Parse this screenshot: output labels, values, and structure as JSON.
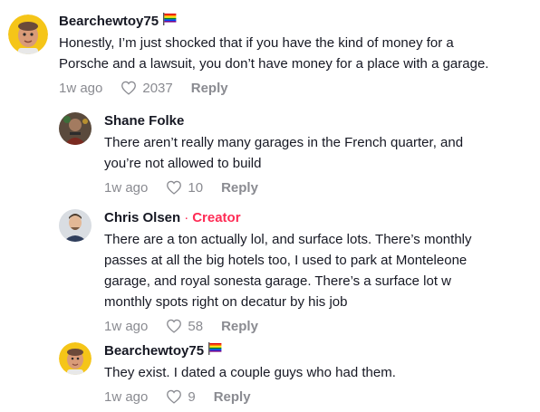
{
  "comments": [
    {
      "username": "Bearchewtoy75",
      "flag": "rainbow-flag-icon",
      "badge": "",
      "text_lines": [
        "Honestly, I’m just shocked that if you have the kind of money for a",
        "Porsche and a lawsuit, you don’t have money for a place with a garage."
      ],
      "time": "1w ago",
      "likes": "2037",
      "reply_label": "Reply"
    },
    {
      "username": "Shane Folke",
      "flag": "",
      "badge": "",
      "text_lines": [
        "There aren’t really many garages in the French quarter, and",
        "you’re not allowed to build"
      ],
      "time": "1w ago",
      "likes": "10",
      "reply_label": "Reply"
    },
    {
      "username": "Chris Olsen",
      "flag": "",
      "badge_separator": "·",
      "badge": "Creator",
      "text_lines": [
        "There are a ton actually lol, and surface lots. There’s monthly",
        "passes at all the big hotels too, I used to park at Monteleone",
        "garage, and royal sonesta garage. There’s a surface lot w",
        "monthly spots right on decatur by his job"
      ],
      "time": "1w ago",
      "likes": "58",
      "reply_label": "Reply"
    },
    {
      "username": "Bearchewtoy75",
      "flag": "rainbow-flag-icon",
      "badge": "",
      "text_lines": [
        "They exist. I dated a couple guys who had them."
      ],
      "time": "1w ago",
      "likes": "9",
      "reply_label": "Reply"
    }
  ],
  "colors": {
    "accent": "#fe2c55",
    "muted": "#8a8b91",
    "text": "#161823"
  }
}
